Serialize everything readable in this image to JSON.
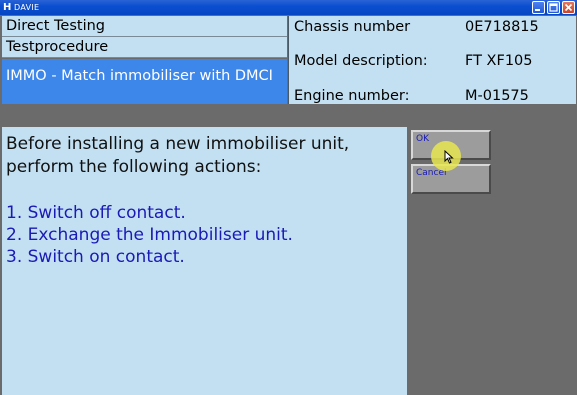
{
  "window": {
    "title": "DAVIE",
    "logo": "H",
    "controls": [
      "minimize-icon",
      "maximize-icon",
      "close-icon"
    ]
  },
  "header": {
    "rows": [
      "Direct Testing",
      "Testprocedure",
      "IMMO - Match immobiliser with DMCI"
    ],
    "selected_row": 2
  },
  "vehicle": {
    "chassis_label": "Chassis number",
    "chassis_value": "0E718815",
    "model_label": "Model description:",
    "model_value": "FT XF105",
    "engine_label": "Engine number:",
    "engine_value": "M-01575"
  },
  "message": {
    "intro": "Before installing a new immobiliser unit, perform the following actions:",
    "steps": [
      "1. Switch off contact.",
      "2. Exchange the Immobiliser unit.",
      "3. Switch on contact."
    ]
  },
  "buttons": {
    "ok": "OK",
    "cancel": "Cancel"
  },
  "colors": {
    "panel": "#c3e0f2",
    "selected": "#3d86ea",
    "step_text": "#1a1ab5",
    "background": "#6b6b6b"
  }
}
